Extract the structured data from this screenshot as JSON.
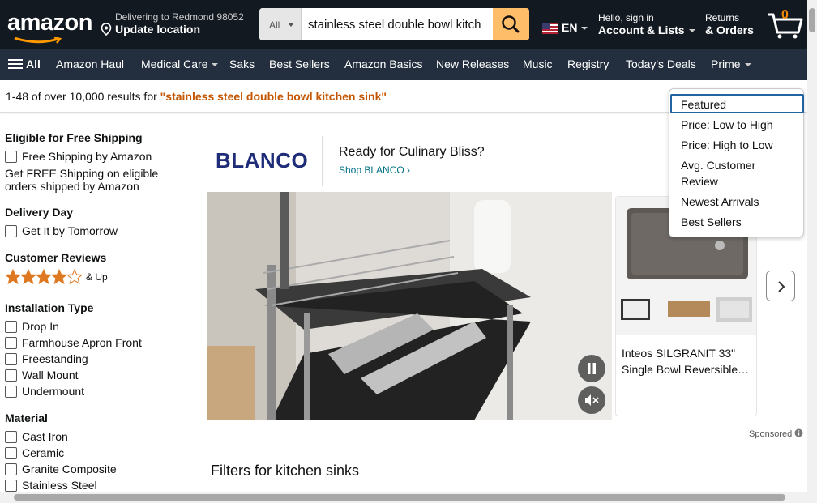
{
  "header": {
    "logo": "amazon",
    "deliver_line1": "Delivering to Redmond 98052",
    "deliver_line2": "Update location",
    "search_category": "All",
    "search_value": "stainless steel double bowl kitch",
    "language": "EN",
    "account_line1": "Hello, sign in",
    "account_line2": "Account & Lists",
    "orders_line1": "Returns",
    "orders_line2": "& Orders",
    "cart_count": "0"
  },
  "nav": {
    "all": "All",
    "items": [
      "Amazon Haul",
      "Medical Care",
      "Saks",
      "Best Sellers",
      "Amazon Basics",
      "New Releases",
      "Music",
      "Registry",
      "Today's Deals",
      "Prime"
    ]
  },
  "results": {
    "summary": "1-48 of over 10,000 results for ",
    "query": "\"stainless steel double bowl kitchen sink\""
  },
  "sidebar": {
    "free_shipping_heading": "Eligible for Free Shipping",
    "free_shipping_option": "Free Shipping by Amazon",
    "free_shipping_note_1": "Get FREE Shipping on eligible",
    "free_shipping_note_2": "orders shipped by Amazon",
    "delivery_heading": "Delivery Day",
    "delivery_option": "Get It by Tomorrow",
    "reviews_heading": "Customer Reviews",
    "reviews_up": "& Up",
    "reviews_stars": 4,
    "install_heading": "Installation Type",
    "install_options": [
      "Drop In",
      "Farmhouse Apron Front",
      "Freestanding",
      "Wall Mount",
      "Undermount"
    ],
    "material_heading": "Material",
    "material_options": [
      "Cast Iron",
      "Ceramic",
      "Granite Composite",
      "Stainless Steel"
    ]
  },
  "ad": {
    "brand": "BLANCO",
    "headline": "Ready for Culinary Bliss?",
    "link": "Shop BLANCO ›",
    "product_title": "Inteos SILGRANIT 33\" Single Bowl Reversible…",
    "sponsored": "Sponsored"
  },
  "filters_heading": "Filters for kitchen sinks",
  "sort_dropdown": {
    "options": [
      "Featured",
      "Price: Low to High",
      "Price: High to Low",
      "Avg. Customer",
      "Review",
      "Newest Arrivals",
      "Best Sellers"
    ],
    "selected": "Featured"
  },
  "colors": {
    "header_bg": "#131921",
    "nav_bg": "#232f3e",
    "search_btn": "#febd69",
    "accent_orange": "#c45500",
    "link": "#007185",
    "star": "#de7921"
  }
}
